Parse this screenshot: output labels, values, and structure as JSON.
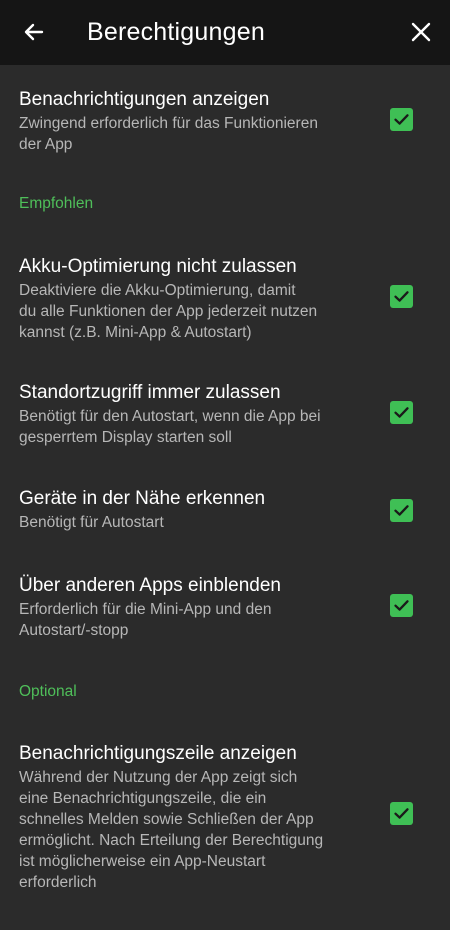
{
  "appbar": {
    "title": "Berechtigungen",
    "back_icon": "arrow-left-icon",
    "close_icon": "close-icon"
  },
  "colors": {
    "background": "#2b2b2b",
    "appbar": "#151515",
    "accent": "#3fbf55",
    "secondary_text": "#b7b7b7"
  },
  "items": [
    {
      "title": "Benachrichtigungen anzeigen",
      "desc_lines": [
        "Zwingend erforderlich für das Funktionieren",
        "der App"
      ],
      "checked": true
    },
    {
      "title": "Akku-Optimierung nicht zulassen",
      "desc_lines": [
        "Deaktiviere die Akku-Optimierung, damit",
        "du alle Funktionen der App jederzeit nutzen",
        "kannst (z.B. Mini-App & Autostart)"
      ],
      "checked": true
    },
    {
      "title": "Standortzugriff immer zulassen",
      "desc_lines": [
        "Benötigt für den Autostart, wenn die App bei",
        "gesperrtem Display starten soll"
      ],
      "checked": true
    },
    {
      "title": "Geräte in der Nähe erkennen",
      "desc_lines": [
        "Benötigt für Autostart"
      ],
      "checked": true
    },
    {
      "title": "Über anderen Apps einblenden",
      "desc_lines": [
        "Erforderlich für die Mini-App und den",
        "Autostart/-stopp"
      ],
      "checked": true
    },
    {
      "title": "Benachrichtigungszeile anzeigen",
      "desc_lines": [
        "Während der Nutzung der App zeigt sich",
        "eine Benachrichtigungszeile, die ein",
        "schnelles Melden sowie Schließen der App",
        "ermöglicht. Nach Erteilung der Berechtigung",
        "ist möglicherweise ein App-Neustart",
        "erforderlich"
      ],
      "checked": true
    }
  ],
  "sections": {
    "recommended": "Empfohlen",
    "optional": "Optional"
  }
}
